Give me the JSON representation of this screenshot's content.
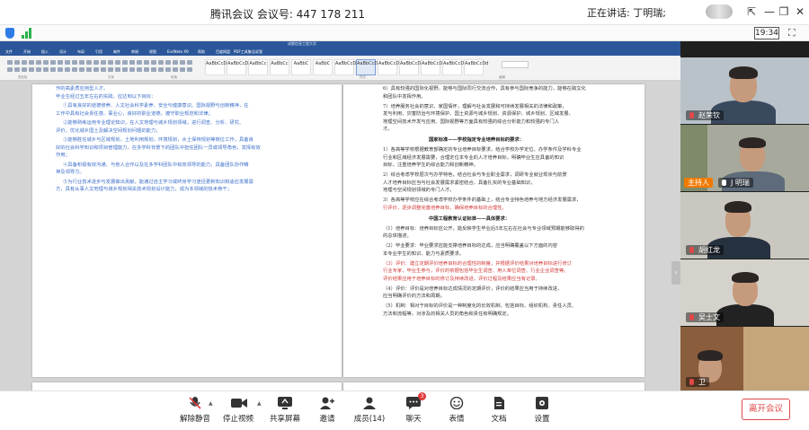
{
  "titlebar": {
    "app_name": "腾讯会议",
    "meeting_id_label": "会议号:",
    "meeting_id": "447 178 211",
    "speaking_label": "正在讲话: 丁明瑞;",
    "pin_icon": "pin-icon",
    "minimize_icon": "minimize-icon",
    "restore_icon": "restore-icon",
    "close_icon": "close-icon"
  },
  "infobar": {
    "time": "19:34",
    "shield_icon": "shield-icon",
    "signal_icon": "signal-icon",
    "fullscreen_icon": "fullscreen-icon"
  },
  "word": {
    "title": "成都信息工程大学",
    "tabs": [
      "文件",
      "开始",
      "插入",
      "设计",
      "布局",
      "引用",
      "邮件",
      "审阅",
      "视图",
      "EndNote X9",
      "帮助",
      "百度网盘",
      "PDF工具集",
      "告诉我"
    ],
    "styles": [
      "AaBbCcDd",
      "AaBbCcDd",
      "AaBbCc",
      "AaBbCc",
      "AaBbC",
      "AaBbC",
      "AaBbCcD",
      "AaBbCcD",
      "AaBbCcD",
      "AaBbCcDd",
      "AaBbCcDd",
      "AaBbCcDd",
      "AaBbCcDd"
    ],
    "group_labels": [
      "剪贴板",
      "字体",
      "段落",
      "样式",
      "编辑"
    ],
    "left_page": {
      "lines": [
        {
          "t": "作的高素质应用型人才。",
          "c": "blue"
        },
        {
          "t": "毕业生经过五年左右的实践，应达到以下目标：",
          "c": "blue"
        },
        {
          "t": "①具有良好的道德修养、人文社会科学素养、安全与健康意识、国际视野与创新精神，在",
          "c": "blue"
        },
        {
          "t": "工作中具有社会责任感、事业心，良好的职业道德，遵守职业规范和法律；",
          "c": "blue"
        },
        {
          "t": "②能够熟练运用专业理论知识，在人文地理与城乡规划领域，进行调查、分析、研究、",
          "c": "blue"
        },
        {
          "t": "评价，优化城乡国土及解决空间规划问题的能力；",
          "c": "blue"
        },
        {
          "t": "③能够胜任城乡与区域规划，土地利用规划，环境规划，水土保持规划等岗位工作，具备良",
          "c": "blue"
        },
        {
          "t": "好的社会科学知识和项目管理能力，在多学科背景下的团队中担任团队一员或领导角色，发挥有效",
          "c": "blue"
        },
        {
          "t": "作用；",
          "c": "blue"
        },
        {
          "t": "④具备积极有效沟通、与他人合作以及在多学科团队中有效领导的能力，具备团队协作精",
          "c": "blue"
        },
        {
          "t": "神及领导力。",
          "c": "blue"
        },
        {
          "t": "⑤为行业技术进步与发展做出贡献，能通过自主学习或终身学习途径更新知识和适应发展需",
          "c": "blue"
        },
        {
          "t": "方，具有从事人文地理与城乡规划相关技术规划设计能力，成为本领域的技术骨干；",
          "c": "blue"
        }
      ]
    },
    "right_page": {
      "lines": [
        {
          "t": "6）具有较强的国际化视野，能够与国际同行交流合作，具有参与国际竞争的能力，能够在跨文化",
          "c": ""
        },
        {
          "t": "和团队中发挥作用。",
          "c": ""
        },
        {
          "t": "7）培养服务社会的意识、家国情怀，理解与社会发展和可持续发展相关的法律和政策，",
          "c": ""
        },
        {
          "t": "发与利用、灾害防治与环境保护、国土资源与城乡规划、资源保护、城乡规划、区域发展、",
          "c": ""
        },
        {
          "t": "地理空间技术开发与应用、国际视野等方面具有较强的综合分析能力和较强的专门人",
          "c": ""
        },
        {
          "t": "才。",
          "c": ""
        },
        {
          "t": "国家标准——学校指定专业培养目标的要求：",
          "c": "head"
        },
        {
          "t": "1）各高等学校根据教育部确定的专业培养目标要求，结合学校办学定位、办学条件及学科专业",
          "c": ""
        },
        {
          "t": "行业和区域经济发展需要，合理定位本专业的人才培养目标，明确毕业生应具备的知识",
          "c": ""
        },
        {
          "t": "目标，注重培养学生的综合能力和创新精神。",
          "c": ""
        },
        {
          "t": "2）综合考虑学校层次与办学特色，结合社会与专业职业需求，调研专业就业现状与前景",
          "c": ""
        },
        {
          "t": "人才培养目标应当与社会发展需求紧密结合，具备扎实的专业基础知识，",
          "c": ""
        },
        {
          "t": "地理与空间规划领域的专门人才。",
          "c": ""
        },
        {
          "t": "3）各高等学校应在综合考虑学校办学条件的基础上，结合专业特色培养与地方经济发展需求，",
          "c": ""
        },
        {
          "t": "行评价，逐步调整完善培养目标，确保培养目标的合理性。",
          "c": "red"
        },
        {
          "t": "中国工程教育认证标准——具体要求：",
          "c": "head"
        },
        {
          "t": "（1）培养目标：培养目标应公开，能反映学生毕业后5年左右在社会与专业领域预期能够取得的",
          "c": ""
        },
        {
          "t": "的总体描述。",
          "c": ""
        },
        {
          "t": "（2）毕业要求：毕业要求应能支撑培养目标的达成，应当明确覆盖以下方面的内容",
          "c": ""
        },
        {
          "t": "本专业学生的知识、能力与素质要求。",
          "c": ""
        },
        {
          "t": "（3）评价：建立定期评价培养目标的合理性的制度，并根据评价结果对培养目标进行修订",
          "c": "red"
        },
        {
          "t": "行业专家，毕业生参与，评价的依据包括毕业生调查、用人单位调查、行业企业调查等。",
          "c": "red"
        },
        {
          "t": "评价结果应用于培养目标的修订及持续改进，评价过程及结果应当有记录。",
          "c": "red"
        },
        {
          "t": "（4）评价：评价是对培养目标达成情况的定期评价，评价的结果应当用于持续改进，",
          "c": ""
        },
        {
          "t": "应当明确评价的方法和周期。",
          "c": ""
        },
        {
          "t": "（5）机制：相对于目标的评价是一种制度化的长效机制，包括目标、组织机构、责任人员、",
          "c": ""
        },
        {
          "t": "方法和流程等，对涉及的相关人员的角色和责任有明确规定。",
          "c": ""
        }
      ]
    }
  },
  "participants": [
    {
      "name": "赵荣钦",
      "host": false,
      "muted": true
    },
    {
      "name": "J 明瑞",
      "host": true,
      "host_label": "主持人",
      "muted": false
    },
    {
      "name": "胡红龙",
      "host": false,
      "muted": true
    },
    {
      "name": "吴士文",
      "host": false,
      "muted": true
    },
    {
      "name": "卫",
      "host": false,
      "muted": true
    }
  ],
  "toolbar": {
    "mute": "解除静音",
    "video": "停止视频",
    "share": "共享屏幕",
    "invite": "邀请",
    "members": "成员(14)",
    "chat": "聊天",
    "chat_badge": "3",
    "emoji": "表情",
    "docs": "文档",
    "settings": "设置",
    "leave": "离开会议"
  }
}
